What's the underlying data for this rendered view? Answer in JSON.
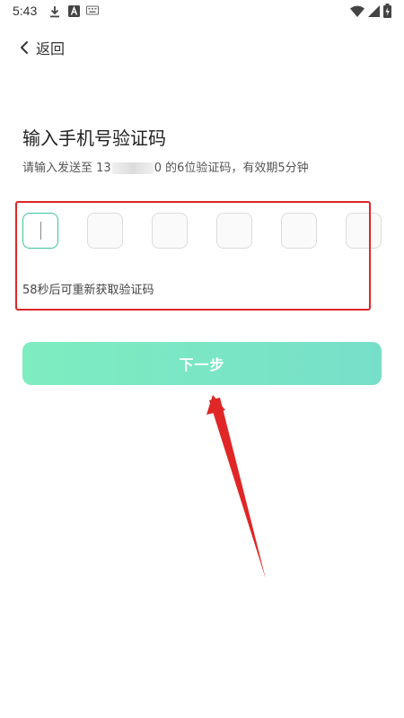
{
  "status_bar": {
    "time": "5:43",
    "icons": [
      "download-icon",
      "a-icon",
      "keyboard-icon",
      "wifi-icon",
      "signal-icon",
      "battery-icon"
    ]
  },
  "header": {
    "back_label": "返回",
    "back_icon": "chevron-left-icon"
  },
  "main": {
    "title": "输入手机号验证码",
    "subtitle_prefix": "请输入发送至 13",
    "subtitle_suffix": "0 的6位验证码，有效期5分钟",
    "code_digits": [
      "",
      "",
      "",
      "",
      "",
      ""
    ],
    "resend_text": "58秒后可重新获取验证码",
    "next_button_label": "下一步"
  },
  "colors": {
    "accent_start": "#7eedc0",
    "accent_end": "#77dfc9",
    "active_border": "#3cc2a0",
    "annotation_red": "#e02626"
  }
}
